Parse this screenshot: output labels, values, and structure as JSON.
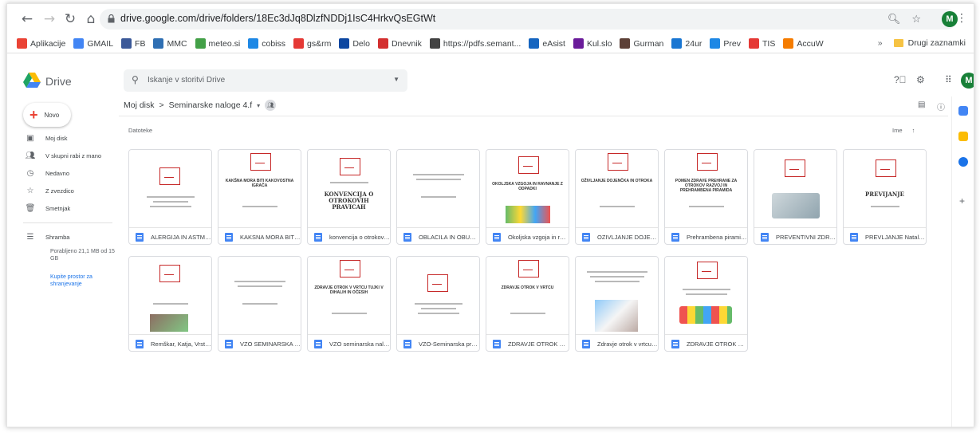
{
  "browser": {
    "url": "drive.google.com/drive/folders/18Ec3dJq8DlzfNDDj1IsC4HrkvQsEGtWt",
    "avatar_letter": "M",
    "bookmarks": [
      {
        "label": "Aplikacije",
        "color": "#ea4335"
      },
      {
        "label": "GMAIL",
        "color": "#4285f4"
      },
      {
        "label": "FB",
        "color": "#3b5998"
      },
      {
        "label": "MMC",
        "color": "#2f6fb3"
      },
      {
        "label": "meteo.si",
        "color": "#43a047"
      },
      {
        "label": "cobiss",
        "color": "#1e88e5"
      },
      {
        "label": "gs&rm",
        "color": "#e53935"
      },
      {
        "label": "Delo",
        "color": "#0d47a1"
      },
      {
        "label": "Dnevnik",
        "color": "#d32f2f"
      },
      {
        "label": "https://pdfs.semant...",
        "color": "#424242"
      },
      {
        "label": "eAsist",
        "color": "#1565c0"
      },
      {
        "label": "Kul.slo",
        "color": "#6a1b9a"
      },
      {
        "label": "Gurman",
        "color": "#5d4037"
      },
      {
        "label": "24ur",
        "color": "#1976d2"
      },
      {
        "label": "Prev",
        "color": "#1e88e5"
      },
      {
        "label": "TIS",
        "color": "#e53935"
      },
      {
        "label": "AccuW",
        "color": "#f57c00"
      }
    ],
    "other_bookmarks": "Drugi zaznamki",
    "more_bookmarks": "»"
  },
  "drive": {
    "title": "Drive",
    "search_placeholder": "Iskanje v storitvi Drive",
    "new_label": "Novo",
    "nav": [
      {
        "label": "Moj disk",
        "icon": "drive-icon"
      },
      {
        "label": "V skupni rabi z mano",
        "icon": "people-icon"
      },
      {
        "label": "Nedavno",
        "icon": "clock-icon"
      },
      {
        "label": "Z zvezdico",
        "icon": "star-icon"
      },
      {
        "label": "Smetnjak",
        "icon": "trash-icon"
      }
    ],
    "storage_label": "Shramba",
    "storage_used": "Porabljeno 21,1 MB od 15",
    "storage_unit": "GB",
    "buy_storage_1": "Kupite prostor za",
    "buy_storage_2": "shranjevanje",
    "breadcrumb_root": "Moj disk",
    "breadcrumb_sep": ">",
    "breadcrumb_folder": "Seminarske naloge 4.f",
    "section_label": "Datoteke",
    "sort_label": "Ime",
    "sort_arrow": "↑"
  },
  "files": [
    {
      "name": "ALERGIJA IN ASTMA...",
      "thumb": "logo",
      "t": ""
    },
    {
      "name": "KAKSNA MORA BITI K...",
      "thumb": "text",
      "t": "KAKŠNA MORA BITI KAKOVOSTNA IGRAČA"
    },
    {
      "name": "konvencija o otrokovi...",
      "thumb": "serif",
      "t": "KONVENCIJA O OTROKOVIH PRAVICAH"
    },
    {
      "name": "OBLACILA IN OBUTEV...",
      "thumb": "lines",
      "t": ""
    },
    {
      "name": "Okoljska vzgoja in rav...",
      "thumb": "green",
      "t": "OKOLJSKA VZGOJA IN RAVNANJE Z ODPADKI"
    },
    {
      "name": "OZIVLJANJE DOJENC...",
      "thumb": "text",
      "t": "OŽIVLJANJE DOJENČKA IN OTROKA"
    },
    {
      "name": "Prehrambena piramid...",
      "thumb": "text",
      "t": "POMEN ZDRAVE PREHRANE ZA OTROKOV RAZVOJ IN PREHRAMBENA PIRAMIDA"
    },
    {
      "name": "PREVENTIVNI ZDRAV...",
      "thumb": "steth",
      "t": ""
    },
    {
      "name": "PREVLJANJE Natalija ...",
      "thumb": "serif-big",
      "t": "PREVIJANJE"
    },
    {
      "name": "Remškar, Katja, Vrste ...",
      "thumb": "photo",
      "t": ""
    },
    {
      "name": "VZO SEMINARSKA N...",
      "thumb": "lines",
      "t": ""
    },
    {
      "name": "VZO seminarska nalo...",
      "thumb": "text",
      "t": "ZDRAVJE OTROK V VRTCU TUJKI V DIHALIH IN OČESIH"
    },
    {
      "name": "VZO-Seminarska pred...",
      "thumb": "logo",
      "t": ""
    },
    {
      "name": "ZDRAVJE OTROK V V...",
      "thumb": "text",
      "t": "ZDRAVJE OTROK V VRTCU"
    },
    {
      "name": "Zdravje otrok v vrtcu; ...",
      "thumb": "child",
      "t": ""
    },
    {
      "name": "ZDRAVJE OTROK V V...",
      "thumb": "kids",
      "t": ""
    }
  ]
}
